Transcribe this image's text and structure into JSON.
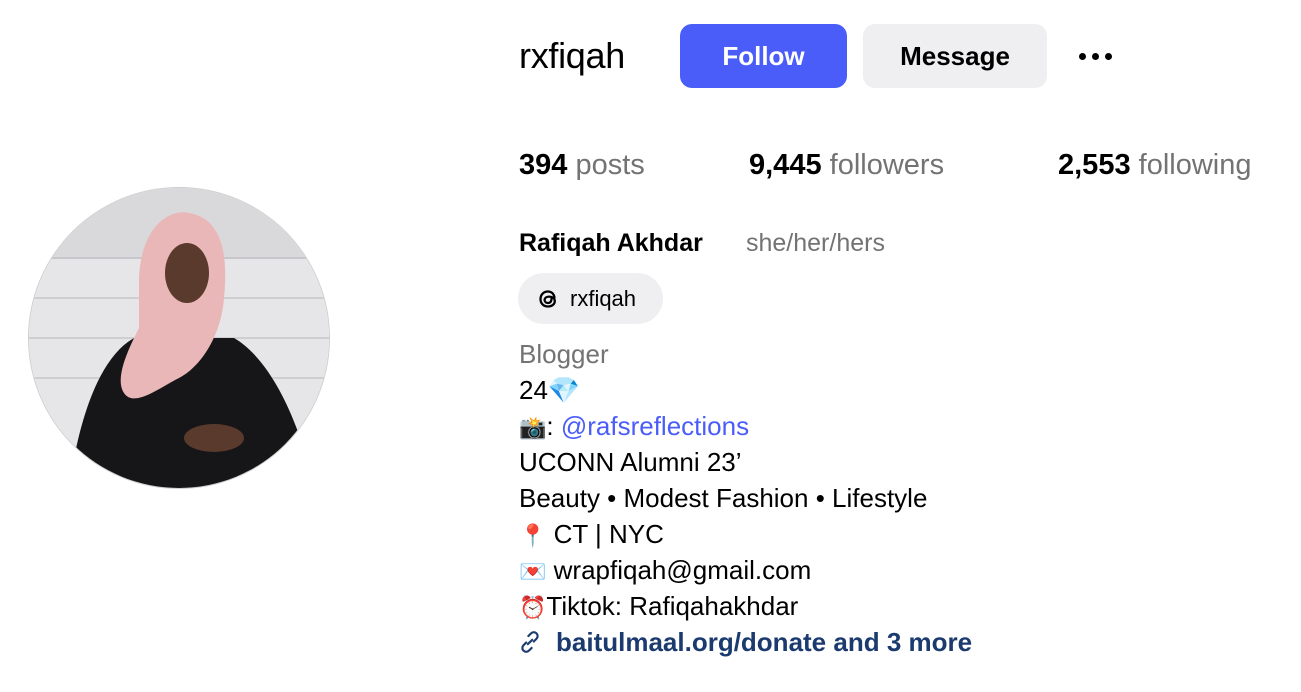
{
  "profile": {
    "username": "rxfiqah",
    "full_name": "Rafiqah Akhdar",
    "pronouns": "she/her/hers"
  },
  "actions": {
    "follow_label": "Follow",
    "message_label": "Message"
  },
  "stats": {
    "posts_count": "394",
    "posts_label": "posts",
    "followers_count": "9,445",
    "followers_label": "followers",
    "following_count": "2,553",
    "following_label": "following"
  },
  "threads": {
    "handle": "rxfiqah",
    "icon": "threads-icon"
  },
  "bio": {
    "category": "Blogger",
    "line_age": "24💎",
    "camera_emoji": "📸",
    "camera_sep": ": ",
    "mention": "@rafsreflections",
    "line_school": "UCONN Alumni 23’",
    "line_topics": "Beauty • Modest Fashion • Lifestyle",
    "pin_emoji": "📍",
    "line_location": " CT | NYC",
    "mail_emoji": "💌",
    "line_email": " wrapfiqah@gmail.com",
    "clock_emoji": "⏰",
    "line_tiktok": "Tiktok: Rafiqahakhdar"
  },
  "link": {
    "text": "baitulmaal.org/donate and 3 more",
    "icon": "link-icon"
  },
  "colors": {
    "accent": "#4a5df9",
    "secondary_button_bg": "#efeff2",
    "muted_text": "#737373",
    "link_text": "#1b3b6f"
  }
}
